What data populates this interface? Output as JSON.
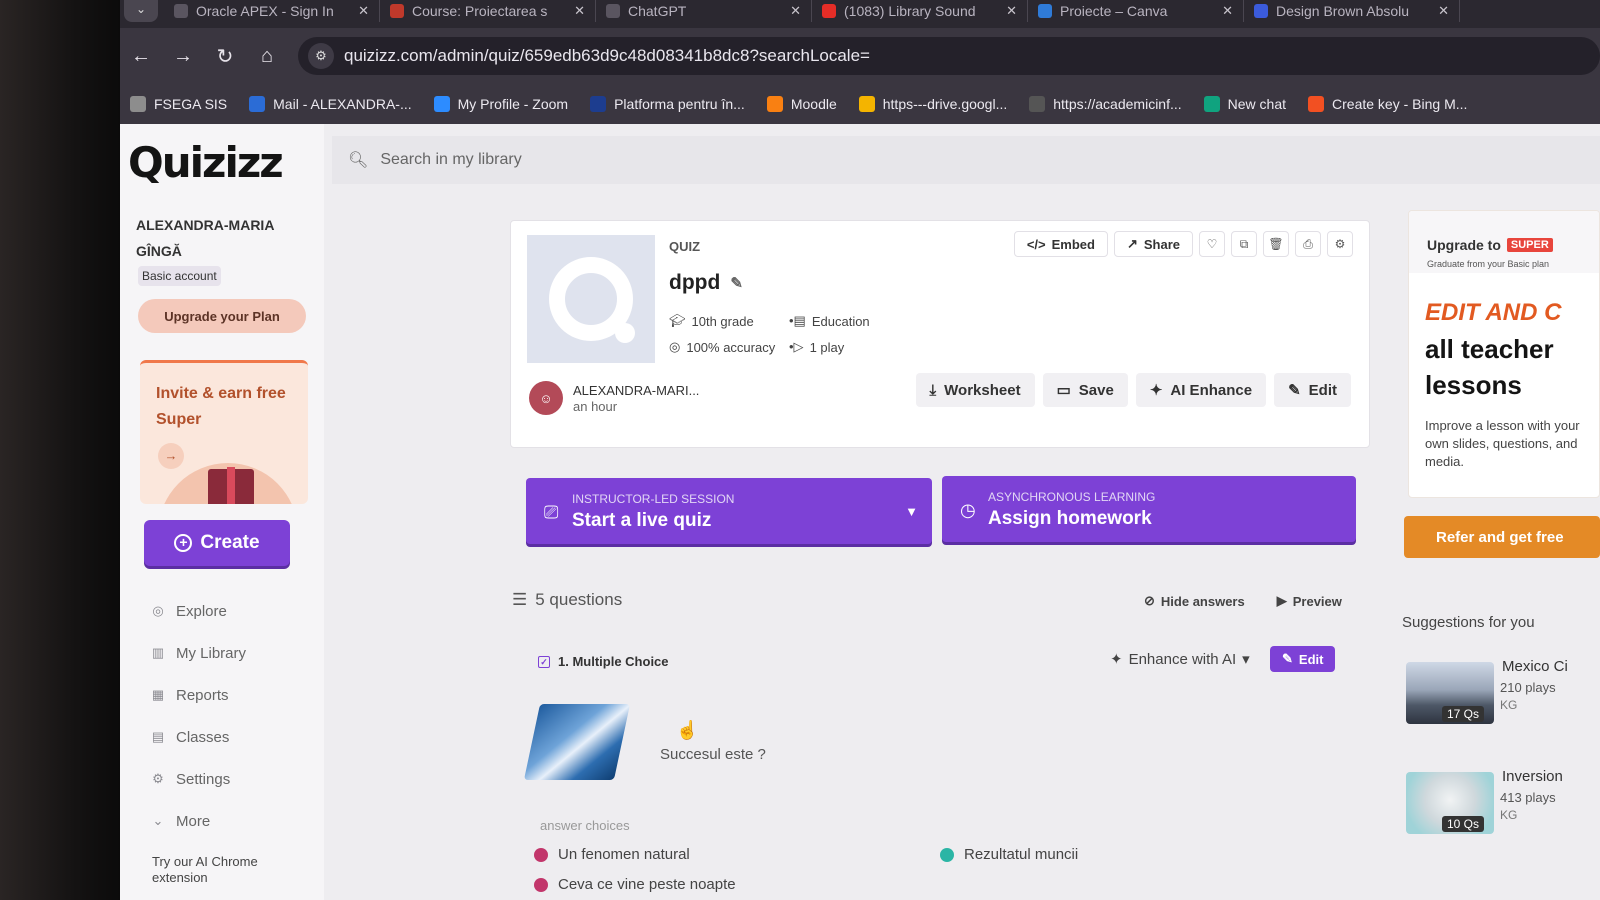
{
  "browser": {
    "tabs": [
      {
        "title": "Oracle APEX - Sign In",
        "color": "#5a5560"
      },
      {
        "title": "Course: Proiectarea s",
        "color": "#c0392b"
      },
      {
        "title": "ChatGPT",
        "color": "#5a5560"
      },
      {
        "title": "(1083) Library Sound",
        "color": "#e52d27"
      },
      {
        "title": "Proiecte – Canva",
        "color": "#2f7bd8"
      },
      {
        "title": "Design Brown Absolu",
        "color": "#3b5bdb"
      }
    ],
    "url": "quizizz.com/admin/quiz/659edb63d9c48d08341b8dc8?searchLocale=",
    "bookmarks": [
      {
        "label": "FSEGA SIS",
        "color": "#8d8d8d"
      },
      {
        "label": "Mail - ALEXANDRA-...",
        "color": "#2b6cd6"
      },
      {
        "label": "My Profile - Zoom",
        "color": "#2d8cff"
      },
      {
        "label": "Platforma pentru în...",
        "color": "#1d3d8f"
      },
      {
        "label": "Moodle",
        "color": "#f98012"
      },
      {
        "label": "https---drive.googl...",
        "color": "#f4b400"
      },
      {
        "label": "https://academicinf...",
        "color": "#555555"
      },
      {
        "label": "New chat",
        "color": "#10a37f"
      },
      {
        "label": "Create key - Bing M...",
        "color": "#f25022"
      }
    ]
  },
  "app": {
    "logo": "Quizizz",
    "search_placeholder": "Search in my library",
    "accent": "#7d41d6"
  },
  "sidebar": {
    "user_name": "ALEXANDRA-MARIA GÎNGĂ",
    "account": "Basic account",
    "upgrade": "Upgrade your Plan",
    "invite": "Invite & earn free Super",
    "create": "Create",
    "nav": [
      {
        "label": "Explore",
        "icon": "compass-icon"
      },
      {
        "label": "My Library",
        "icon": "library-icon"
      },
      {
        "label": "Reports",
        "icon": "reports-icon"
      },
      {
        "label": "Classes",
        "icon": "classes-icon"
      },
      {
        "label": "Settings",
        "icon": "settings-icon"
      },
      {
        "label": "More",
        "icon": "chevron-down-icon"
      }
    ],
    "chrome_ext": "Try our AI Chrome extension"
  },
  "quiz": {
    "type": "QUIZ",
    "title": "dppd",
    "grade": "10th grade",
    "subject": "Education",
    "accuracy": "100% accuracy",
    "plays": "1 play",
    "author": "ALEXANDRA-MARI...",
    "time": "an hour",
    "embed": "Embed",
    "share": "Share",
    "worksheet": "Worksheet",
    "save": "Save",
    "ai_enhance": "AI Enhance",
    "edit": "Edit"
  },
  "session": {
    "live_sub": "INSTRUCTOR-LED SESSION",
    "live_main": "Start a live quiz",
    "hw_sub": "ASYNCHRONOUS LEARNING",
    "hw_main": "Assign homework"
  },
  "questions": {
    "count": "5 questions",
    "hide_answers": "Hide answers",
    "preview": "Preview",
    "items": [
      {
        "header": "1. Multiple Choice",
        "enhance": "Enhance with AI",
        "edit": "Edit",
        "text": "Succesul este ?",
        "answer_label": "answer choices",
        "answers": [
          {
            "text": "Un fenomen natural",
            "color": "#c2366b"
          },
          {
            "text": "Rezultatul muncii",
            "color": "#2bb5a5"
          },
          {
            "text": "Ceva ce vine peste noapte",
            "color": "#c2366b"
          }
        ]
      }
    ]
  },
  "promo": {
    "upgrade_to": "Upgrade to",
    "super": "SUPER",
    "graduate": "Graduate from your Basic plan",
    "edit_and": "EDIT AND C",
    "teacher_line1": "all teacher",
    "teacher_line2": "lessons",
    "desc": "Improve a lesson with your own slides, questions, and media."
  },
  "refer": "Refer and get free",
  "suggestions": {
    "title": "Suggestions for you",
    "items": [
      {
        "name": "Mexico Ci",
        "plays": "210 plays",
        "grade": "KG",
        "qs": "17 Qs"
      },
      {
        "name": "Inversion",
        "plays": "413 plays",
        "grade": "KG",
        "qs": "10 Qs"
      }
    ]
  }
}
